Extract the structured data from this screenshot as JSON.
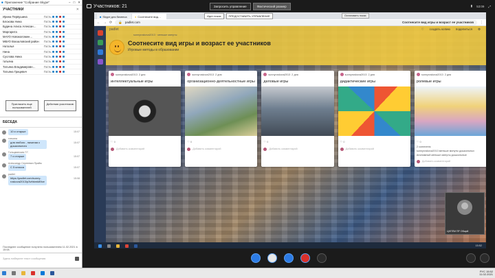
{
  "window": {
    "title": "Приложение \"Собрание Skype\""
  },
  "participants": {
    "title": "УЧАСТНИКИ",
    "items": [
      {
        "name": "Ирина Первушина",
        "role": "Гость"
      },
      {
        "name": "Блохова Нина",
        "role": "Гость"
      },
      {
        "name": "Будина Алиса Алексан…",
        "role": "Гость"
      },
      {
        "name": "Маргарита",
        "role": "Гость"
      },
      {
        "name": "МАУО Новоколомен…",
        "role": "Гость"
      },
      {
        "name": "МБУО Вокзаловский район",
        "role": "Гость"
      },
      {
        "name": "Наталья",
        "role": "Гость"
      },
      {
        "name": "Нина",
        "role": "Гость"
      },
      {
        "name": "Суслова Нина",
        "role": "Гость"
      },
      {
        "name": "татьяна",
        "role": "Гость"
      },
      {
        "name": "Татьяна Владимировн…",
        "role": "Гость"
      },
      {
        "name": "Татьяна Грицевич",
        "role": "Гость"
      }
    ],
    "invite_button": "Пригласить еще пользователей",
    "actions_button": "Действия участников"
  },
  "chat": {
    "title": "БЕСЕДА",
    "messages": [
      {
        "author": "",
        "text": "10 и старше",
        "time": "15:07"
      },
      {
        "author": "татьяна",
        "text": "для любого , начиная с дошкольного",
        "time": "15:07"
      },
      {
        "author": "Гольцманская Т.Г.",
        "text": "7 и старше",
        "time": "15:07"
      },
      {
        "author": "Александр Сергеевич Прайм",
        "text": "С 5 класса",
        "time": "15:07"
      },
      {
        "author": "padlet",
        "text": "https://padlet.com/sunny-roskova2013/p3vthkmk89ce",
        "time": "15:08"
      }
    ],
    "footer": "Последнее сообщение получено пользователем 11.02.2021 в 15:08.",
    "compose_placeholder": "Здесь наберите текст сообщения"
  },
  "share": {
    "participants_label": "Участников: 21",
    "request_control": "Запросить управление",
    "actual_size": "Фактический размер",
    "topright": "53:09"
  },
  "browser": {
    "tabs": [
      "Skype для бизнеса",
      "Соотнесите вид…"
    ],
    "share_label": "Идет показ",
    "share_control": "ПРЕДОСТАВИТЬ УПРАВЛЕНИЕ",
    "stop_label": "Остановить показ",
    "url_domain": "padlet.com",
    "page_title": "Соотнесите вид игры и возраст ее участников"
  },
  "padlet": {
    "brand": "padlet",
    "author": "sunnyroskova2013 · меньше минуты",
    "title": "Соотнесите вид игры и возраст ее участников",
    "subtitle": "Игровые методы в образовании",
    "actions": [
      "♡",
      "создать копию",
      "поделиться"
    ],
    "cards": [
      {
        "author": "sunnyroskova2013",
        "when": "2 дня",
        "title": "интеллектуальные игры",
        "likes": "♡ 0",
        "comment": "Добавить комментарий"
      },
      {
        "author": "sunnyroskova2013",
        "when": "2 дня",
        "title": "организационно-деятельностные игры",
        "likes": "♡ 0",
        "comment": "Добавить комментарий"
      },
      {
        "author": "sunnyroskova2013",
        "when": "2 дня",
        "title": "деловые игры",
        "likes": "♡ 0",
        "comment": "Добавить комментарий"
      },
      {
        "author": "sunnyroskova2013",
        "when": "2 дня",
        "title": "дидактические игры",
        "likes": "♡ 0",
        "comment": "Добавить комментарий"
      },
      {
        "author": "sunnyroskova2013",
        "when": "2 дня",
        "title": "ролевые игры",
        "likes": "♡ 0",
        "comment": "Добавить комментарий"
      }
    ],
    "extra_comments": "2 comments",
    "extra_c1": "sunnyroskova2013 меньше минуты дошкольных",
    "extra_c2": "Анонимный меньше минуты дошкольные"
  },
  "video": {
    "name": "ЦНППМ ПР Общий"
  },
  "taskbar": {
    "time": "15:52",
    "date": "11.02.2021",
    "lang": "РУС"
  },
  "colors": {
    "padlet_header": "#f0ca40",
    "bubble": "#cfe6fb",
    "hangup": "#d9302b",
    "accent": "#2c7be5"
  }
}
